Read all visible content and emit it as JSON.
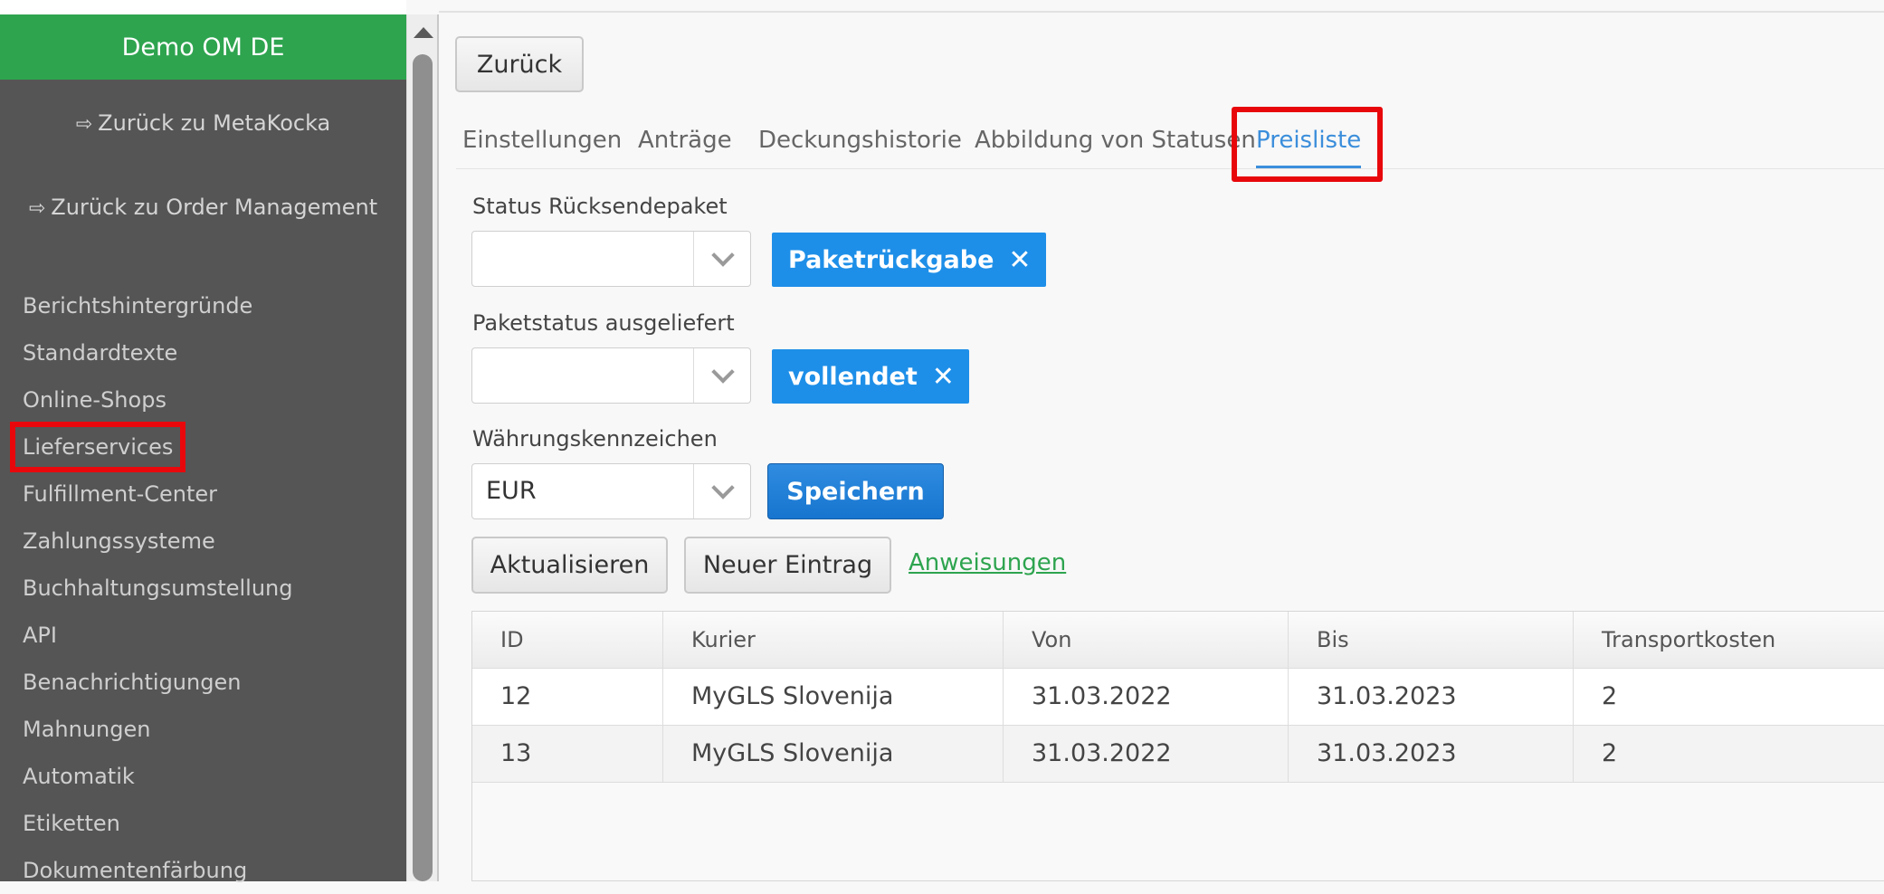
{
  "sidebar": {
    "brand": "Demo OM DE",
    "back_links": [
      "Zurück zu MetaKocka",
      "Zurück zu Order Management"
    ],
    "items": [
      {
        "label": "Berichtshintergründe"
      },
      {
        "label": "Standardtexte"
      },
      {
        "label": "Online-Shops"
      },
      {
        "label": "Lieferservices",
        "active": true
      },
      {
        "label": "Fulfillment-Center"
      },
      {
        "label": "Zahlungssysteme"
      },
      {
        "label": "Buchhaltungsumstellung"
      },
      {
        "label": "API"
      },
      {
        "label": "Benachrichtigungen"
      },
      {
        "label": "Mahnungen"
      },
      {
        "label": "Automatik"
      },
      {
        "label": "Etiketten"
      },
      {
        "label": "Dokumentenfärbung"
      }
    ]
  },
  "main": {
    "back_button": "Zurück",
    "tabs": [
      "Einstellungen",
      "Anträge",
      "Deckungshistorie",
      "Abbildung von Statusen",
      "Preisliste"
    ],
    "active_tab": "Preisliste",
    "fields": {
      "status_return": {
        "label": "Status Rücksendepaket",
        "value": "",
        "tag": "Paketrückgabe"
      },
      "status_delivered": {
        "label": "Paketstatus ausgeliefert",
        "value": "",
        "tag": "vollendet"
      },
      "currency": {
        "label": "Währungskennzeichen",
        "value": "EUR"
      }
    },
    "save_button": "Speichern",
    "refresh_button": "Aktualisieren",
    "new_entry_button": "Neuer Eintrag",
    "instructions_link": "Anweisungen"
  },
  "table": {
    "columns": [
      "ID",
      "Kurier",
      "Von",
      "Bis",
      "Transportkosten"
    ],
    "rows": [
      [
        "12",
        "MyGLS Slovenija",
        "31.03.2022",
        "31.03.2023",
        "2"
      ],
      [
        "13",
        "MyGLS Slovenija",
        "31.03.2022",
        "31.03.2023",
        "2"
      ]
    ]
  },
  "colors": {
    "brand_green": "#2ea44f",
    "sidebar_bg": "#555555",
    "accent_blue": "#1e8fe8",
    "highlight_red": "#e8080c"
  },
  "icons": {
    "back_link_icon": "sign-out-icon",
    "tag_remove_icon": "close-icon",
    "select_icon": "chevron-down-icon"
  }
}
